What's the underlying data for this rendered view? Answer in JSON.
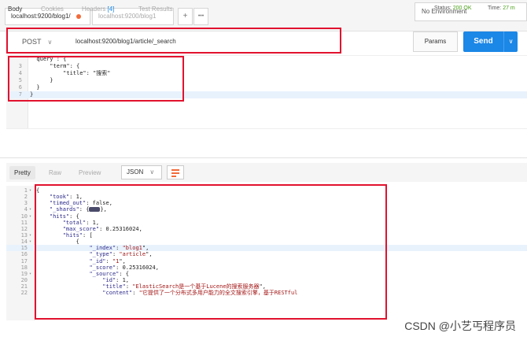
{
  "tabs": {
    "active": {
      "label": "localhost:9200/blog1/"
    },
    "second": {
      "label": "localhost:9200/blog1"
    },
    "add": "+",
    "more": "•••"
  },
  "environment": "No Environment",
  "request": {
    "method": "POST",
    "url": "localhost:9200/blog1/article/_search",
    "params_label": "Params",
    "send_label": "Send",
    "body_lines": [
      {
        "n": "",
        "text": "  query : {"
      },
      {
        "n": "3",
        "text": "      \"term\": {"
      },
      {
        "n": "4",
        "text": "          \"title\": \"搜索\""
      },
      {
        "n": "5",
        "text": "      }"
      },
      {
        "n": "6",
        "text": "  }"
      },
      {
        "n": "7",
        "text": "}"
      }
    ]
  },
  "response": {
    "tabs": [
      "Body",
      "Cookies",
      "Headers",
      "Test Results"
    ],
    "headers_count": "[4]",
    "status_label": "Status:",
    "status_value": "200 OK",
    "time_label": "Time:",
    "time_value": "27 m",
    "view_modes": [
      "Pretty",
      "Raw",
      "Preview"
    ],
    "format": "JSON",
    "lines": [
      {
        "n": "1",
        "t": "{"
      },
      {
        "n": "2",
        "t": "    \"took\": 1,"
      },
      {
        "n": "3",
        "t": "    \"timed_out\": false,"
      },
      {
        "n": "4",
        "t": "    \"_shards\": {▬},"
      },
      {
        "n": "10",
        "t": "    \"hits\": {"
      },
      {
        "n": "11",
        "t": "        \"total\": 1,"
      },
      {
        "n": "12",
        "t": "        \"max_score\": 0.25316024,"
      },
      {
        "n": "13",
        "t": "        \"hits\": ["
      },
      {
        "n": "14",
        "t": "            {"
      },
      {
        "n": "15",
        "t": "                \"_index\": \"blog1\","
      },
      {
        "n": "16",
        "t": "                \"_type\": \"article\","
      },
      {
        "n": "17",
        "t": "                \"_id\": \"1\","
      },
      {
        "n": "18",
        "t": "                \"_score\": 0.25316024,"
      },
      {
        "n": "19",
        "t": "                \"_source\": {"
      },
      {
        "n": "20",
        "t": "                    \"id\": 1,"
      },
      {
        "n": "21",
        "t": "                    \"title\": \"ElasticSearch是一个基于Lucene的搜索服务器\","
      },
      {
        "n": "22",
        "t": "                    \"content\": \"它提供了一个分布式多用户能力的全文搜索引擎，基于RESTful"
      }
    ]
  },
  "watermark": "CSDN @小艺丐程序员",
  "colors": {
    "send": "#1b87e6",
    "highlight_box": "#e1122e",
    "status_ok": "#4a9f1a",
    "unsaved_dot": "#f26b3a"
  }
}
